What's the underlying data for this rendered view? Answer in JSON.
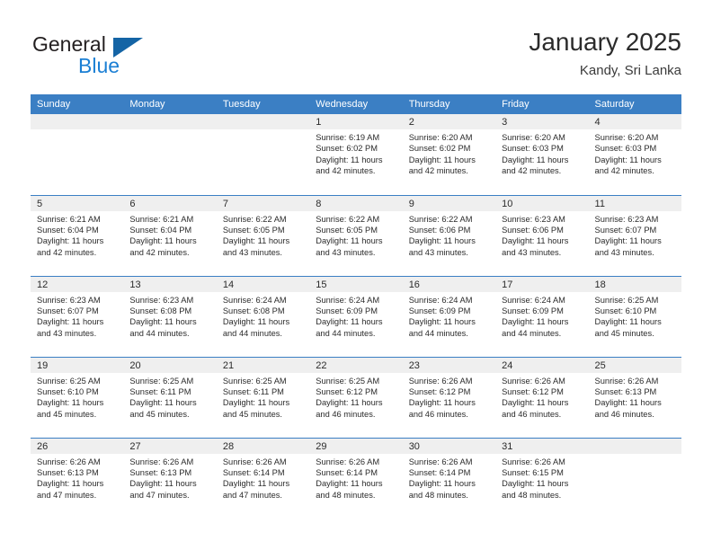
{
  "brand": {
    "name_part1": "General",
    "name_part2": "Blue",
    "triangle_icon": "blue-triangle-icon",
    "color_dark": "#231f20",
    "color_blue": "#1b7fd4"
  },
  "header": {
    "title": "January 2025",
    "subtitle": "Kandy, Sri Lanka"
  },
  "theme": {
    "header_bg": "#3b7fc4",
    "daynum_bg": "#efefef",
    "text": "#2b2b2b",
    "grid_line": "#3b7fc4"
  },
  "weekday_headers": [
    "Sunday",
    "Monday",
    "Tuesday",
    "Wednesday",
    "Thursday",
    "Friday",
    "Saturday"
  ],
  "weeks": [
    [
      {
        "day": "",
        "empty": true,
        "sunrise": "",
        "sunset": "",
        "daylight_line1": "",
        "daylight_line2": ""
      },
      {
        "day": "",
        "empty": true,
        "sunrise": "",
        "sunset": "",
        "daylight_line1": "",
        "daylight_line2": ""
      },
      {
        "day": "",
        "empty": true,
        "sunrise": "",
        "sunset": "",
        "daylight_line1": "",
        "daylight_line2": ""
      },
      {
        "day": "1",
        "empty": false,
        "sunrise": "Sunrise: 6:19 AM",
        "sunset": "Sunset: 6:02 PM",
        "daylight_line1": "Daylight: 11 hours",
        "daylight_line2": "and 42 minutes."
      },
      {
        "day": "2",
        "empty": false,
        "sunrise": "Sunrise: 6:20 AM",
        "sunset": "Sunset: 6:02 PM",
        "daylight_line1": "Daylight: 11 hours",
        "daylight_line2": "and 42 minutes."
      },
      {
        "day": "3",
        "empty": false,
        "sunrise": "Sunrise: 6:20 AM",
        "sunset": "Sunset: 6:03 PM",
        "daylight_line1": "Daylight: 11 hours",
        "daylight_line2": "and 42 minutes."
      },
      {
        "day": "4",
        "empty": false,
        "sunrise": "Sunrise: 6:20 AM",
        "sunset": "Sunset: 6:03 PM",
        "daylight_line1": "Daylight: 11 hours",
        "daylight_line2": "and 42 minutes."
      }
    ],
    [
      {
        "day": "5",
        "empty": false,
        "sunrise": "Sunrise: 6:21 AM",
        "sunset": "Sunset: 6:04 PM",
        "daylight_line1": "Daylight: 11 hours",
        "daylight_line2": "and 42 minutes."
      },
      {
        "day": "6",
        "empty": false,
        "sunrise": "Sunrise: 6:21 AM",
        "sunset": "Sunset: 6:04 PM",
        "daylight_line1": "Daylight: 11 hours",
        "daylight_line2": "and 42 minutes."
      },
      {
        "day": "7",
        "empty": false,
        "sunrise": "Sunrise: 6:22 AM",
        "sunset": "Sunset: 6:05 PM",
        "daylight_line1": "Daylight: 11 hours",
        "daylight_line2": "and 43 minutes."
      },
      {
        "day": "8",
        "empty": false,
        "sunrise": "Sunrise: 6:22 AM",
        "sunset": "Sunset: 6:05 PM",
        "daylight_line1": "Daylight: 11 hours",
        "daylight_line2": "and 43 minutes."
      },
      {
        "day": "9",
        "empty": false,
        "sunrise": "Sunrise: 6:22 AM",
        "sunset": "Sunset: 6:06 PM",
        "daylight_line1": "Daylight: 11 hours",
        "daylight_line2": "and 43 minutes."
      },
      {
        "day": "10",
        "empty": false,
        "sunrise": "Sunrise: 6:23 AM",
        "sunset": "Sunset: 6:06 PM",
        "daylight_line1": "Daylight: 11 hours",
        "daylight_line2": "and 43 minutes."
      },
      {
        "day": "11",
        "empty": false,
        "sunrise": "Sunrise: 6:23 AM",
        "sunset": "Sunset: 6:07 PM",
        "daylight_line1": "Daylight: 11 hours",
        "daylight_line2": "and 43 minutes."
      }
    ],
    [
      {
        "day": "12",
        "empty": false,
        "sunrise": "Sunrise: 6:23 AM",
        "sunset": "Sunset: 6:07 PM",
        "daylight_line1": "Daylight: 11 hours",
        "daylight_line2": "and 43 minutes."
      },
      {
        "day": "13",
        "empty": false,
        "sunrise": "Sunrise: 6:23 AM",
        "sunset": "Sunset: 6:08 PM",
        "daylight_line1": "Daylight: 11 hours",
        "daylight_line2": "and 44 minutes."
      },
      {
        "day": "14",
        "empty": false,
        "sunrise": "Sunrise: 6:24 AM",
        "sunset": "Sunset: 6:08 PM",
        "daylight_line1": "Daylight: 11 hours",
        "daylight_line2": "and 44 minutes."
      },
      {
        "day": "15",
        "empty": false,
        "sunrise": "Sunrise: 6:24 AM",
        "sunset": "Sunset: 6:09 PM",
        "daylight_line1": "Daylight: 11 hours",
        "daylight_line2": "and 44 minutes."
      },
      {
        "day": "16",
        "empty": false,
        "sunrise": "Sunrise: 6:24 AM",
        "sunset": "Sunset: 6:09 PM",
        "daylight_line1": "Daylight: 11 hours",
        "daylight_line2": "and 44 minutes."
      },
      {
        "day": "17",
        "empty": false,
        "sunrise": "Sunrise: 6:24 AM",
        "sunset": "Sunset: 6:09 PM",
        "daylight_line1": "Daylight: 11 hours",
        "daylight_line2": "and 44 minutes."
      },
      {
        "day": "18",
        "empty": false,
        "sunrise": "Sunrise: 6:25 AM",
        "sunset": "Sunset: 6:10 PM",
        "daylight_line1": "Daylight: 11 hours",
        "daylight_line2": "and 45 minutes."
      }
    ],
    [
      {
        "day": "19",
        "empty": false,
        "sunrise": "Sunrise: 6:25 AM",
        "sunset": "Sunset: 6:10 PM",
        "daylight_line1": "Daylight: 11 hours",
        "daylight_line2": "and 45 minutes."
      },
      {
        "day": "20",
        "empty": false,
        "sunrise": "Sunrise: 6:25 AM",
        "sunset": "Sunset: 6:11 PM",
        "daylight_line1": "Daylight: 11 hours",
        "daylight_line2": "and 45 minutes."
      },
      {
        "day": "21",
        "empty": false,
        "sunrise": "Sunrise: 6:25 AM",
        "sunset": "Sunset: 6:11 PM",
        "daylight_line1": "Daylight: 11 hours",
        "daylight_line2": "and 45 minutes."
      },
      {
        "day": "22",
        "empty": false,
        "sunrise": "Sunrise: 6:25 AM",
        "sunset": "Sunset: 6:12 PM",
        "daylight_line1": "Daylight: 11 hours",
        "daylight_line2": "and 46 minutes."
      },
      {
        "day": "23",
        "empty": false,
        "sunrise": "Sunrise: 6:26 AM",
        "sunset": "Sunset: 6:12 PM",
        "daylight_line1": "Daylight: 11 hours",
        "daylight_line2": "and 46 minutes."
      },
      {
        "day": "24",
        "empty": false,
        "sunrise": "Sunrise: 6:26 AM",
        "sunset": "Sunset: 6:12 PM",
        "daylight_line1": "Daylight: 11 hours",
        "daylight_line2": "and 46 minutes."
      },
      {
        "day": "25",
        "empty": false,
        "sunrise": "Sunrise: 6:26 AM",
        "sunset": "Sunset: 6:13 PM",
        "daylight_line1": "Daylight: 11 hours",
        "daylight_line2": "and 46 minutes."
      }
    ],
    [
      {
        "day": "26",
        "empty": false,
        "sunrise": "Sunrise: 6:26 AM",
        "sunset": "Sunset: 6:13 PM",
        "daylight_line1": "Daylight: 11 hours",
        "daylight_line2": "and 47 minutes."
      },
      {
        "day": "27",
        "empty": false,
        "sunrise": "Sunrise: 6:26 AM",
        "sunset": "Sunset: 6:13 PM",
        "daylight_line1": "Daylight: 11 hours",
        "daylight_line2": "and 47 minutes."
      },
      {
        "day": "28",
        "empty": false,
        "sunrise": "Sunrise: 6:26 AM",
        "sunset": "Sunset: 6:14 PM",
        "daylight_line1": "Daylight: 11 hours",
        "daylight_line2": "and 47 minutes."
      },
      {
        "day": "29",
        "empty": false,
        "sunrise": "Sunrise: 6:26 AM",
        "sunset": "Sunset: 6:14 PM",
        "daylight_line1": "Daylight: 11 hours",
        "daylight_line2": "and 48 minutes."
      },
      {
        "day": "30",
        "empty": false,
        "sunrise": "Sunrise: 6:26 AM",
        "sunset": "Sunset: 6:14 PM",
        "daylight_line1": "Daylight: 11 hours",
        "daylight_line2": "and 48 minutes."
      },
      {
        "day": "31",
        "empty": false,
        "sunrise": "Sunrise: 6:26 AM",
        "sunset": "Sunset: 6:15 PM",
        "daylight_line1": "Daylight: 11 hours",
        "daylight_line2": "and 48 minutes."
      },
      {
        "day": "",
        "empty": true,
        "sunrise": "",
        "sunset": "",
        "daylight_line1": "",
        "daylight_line2": ""
      }
    ]
  ]
}
